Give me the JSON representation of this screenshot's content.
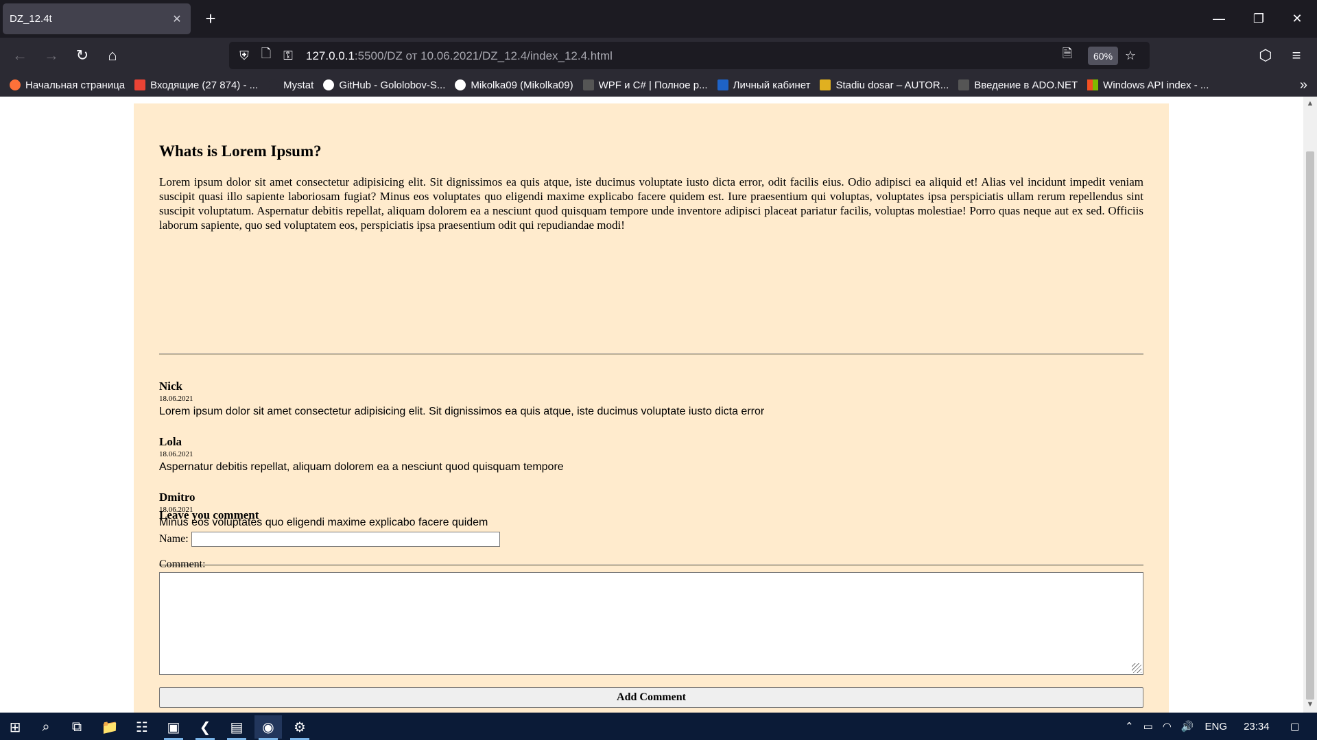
{
  "browser": {
    "tab_title": "DZ_12.4t",
    "url_host": "127.0.0.1",
    "url_rest": ":5500/DZ от 10.06.2021/DZ_12.4/index_12.4.html",
    "zoom": "60%",
    "bookmarks": [
      {
        "label": "Начальная страница",
        "color": "#ff7139"
      },
      {
        "label": "Входящие (27 874) - ...",
        "color": "#ea4335"
      },
      {
        "label": "Mystat",
        "color": "#2b2a33"
      },
      {
        "label": "GitHub - Gololobov-S...",
        "color": "#ffffff"
      },
      {
        "label": "Mikolka09 (Mikolka09)",
        "color": "#ffffff"
      },
      {
        "label": "WPF и C# | Полное р...",
        "color": "#555555"
      },
      {
        "label": "Личный кабинет",
        "color": "#1e63c7"
      },
      {
        "label": "Stadiu dosar – AUTOR...",
        "color": "#e0b020"
      },
      {
        "label": "Введение в ADO.NET",
        "color": "#555555"
      },
      {
        "label": "Windows API index - ...",
        "color": "#f25022"
      }
    ]
  },
  "page": {
    "heading": "Whats is Lorem Ipsum?",
    "intro": "Lorem ipsum dolor sit amet consectetur adipisicing elit. Sit dignissimos ea quis atque, iste ducimus voluptate iusto dicta error, odit facilis eius. Odio adipisci ea aliquid et! Alias vel incidunt impedit veniam suscipit quasi illo sapiente laboriosam fugiat? Minus eos voluptates quo eligendi maxime explicabo facere quidem est. Iure praesentium qui voluptas, voluptates ipsa perspiciatis ullam rerum repellendus sint suscipit voluptatum. Aspernatur debitis repellat, aliquam dolorem ea a nesciunt quod quisquam tempore unde inventore adipisci placeat pariatur facilis, voluptas molestiae! Porro quas neque aut ex sed. Officiis laborum sapiente, quo sed voluptatem eos, perspiciatis ipsa praesentium odit qui repudiandae modi!",
    "comments": [
      {
        "author": "Nick",
        "date": "18.06.2021",
        "text": "Lorem ipsum dolor sit amet consectetur adipisicing elit. Sit dignissimos ea quis atque, iste ducimus voluptate iusto dicta error"
      },
      {
        "author": "Lola",
        "date": "18.06.2021",
        "text": "Aspernatur debitis repellat, aliquam dolorem ea a nesciunt quod quisquam tempore"
      },
      {
        "author": "Dmitro",
        "date": "18.06.2021",
        "text": "Minus eos voluptates quo eligendi maxime explicabo facere quidem"
      }
    ],
    "form": {
      "title": "Leave you comment",
      "name_label": "Name:",
      "name_value": "",
      "comment_label": "Comment:",
      "comment_value": "",
      "submit_label": "Add Comment"
    },
    "bg_color": "#ffebcd"
  },
  "taskbar": {
    "language": "ENG",
    "time": "23:34"
  }
}
